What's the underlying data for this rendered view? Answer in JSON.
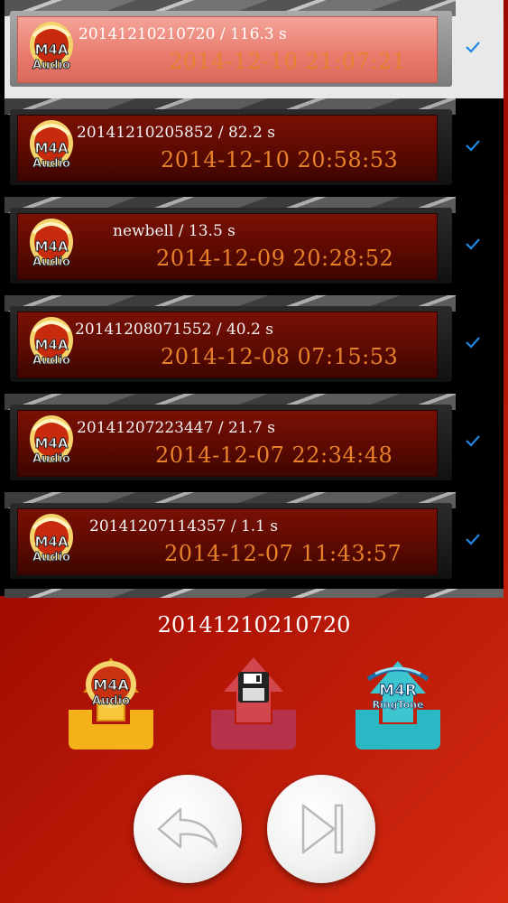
{
  "recordings": [
    {
      "name": "20141210210720",
      "duration": "116.3 s",
      "title": "20141210210720 / 116.3 s",
      "date": "2014-12-10 21:07:21",
      "selected": true
    },
    {
      "name": "20141210205852",
      "duration": "82.2 s",
      "title": "20141210205852 / 82.2 s",
      "date": "2014-12-10 20:58:53",
      "selected": false
    },
    {
      "name": "newbell",
      "duration": "13.5 s",
      "title": "newbell / 13.5 s",
      "date": "2014-12-09 20:28:52",
      "selected": false
    },
    {
      "name": "20141208071552",
      "duration": "40.2 s",
      "title": "20141208071552 / 40.2 s",
      "date": "2014-12-08 07:15:53",
      "selected": false
    },
    {
      "name": "20141207223447",
      "duration": "21.7 s",
      "title": "20141207223447 / 21.7 s",
      "date": "2014-12-07 22:34:48",
      "selected": false
    },
    {
      "name": "20141207114357",
      "duration": "1.1 s",
      "title": "20141207114357 / 1.1 s",
      "date": "2014-12-07 11:43:57",
      "selected": false
    }
  ],
  "file_icon": {
    "line1": "M4A",
    "line2": "Audio"
  },
  "current": {
    "name": "20141210210720"
  },
  "actions": {
    "export_m4a": {
      "line1": "M4A",
      "line2": "Audio",
      "color": "#f3b21a"
    },
    "save": {
      "icon": "floppy-disk-icon",
      "color": "#b5324a"
    },
    "ringtone": {
      "line1": "M4R",
      "line2": "RingTone",
      "color": "#2ab8c4"
    }
  },
  "colors": {
    "check": "#1e88e5",
    "date": "#e6812a",
    "selected_card": "#e8796c"
  }
}
